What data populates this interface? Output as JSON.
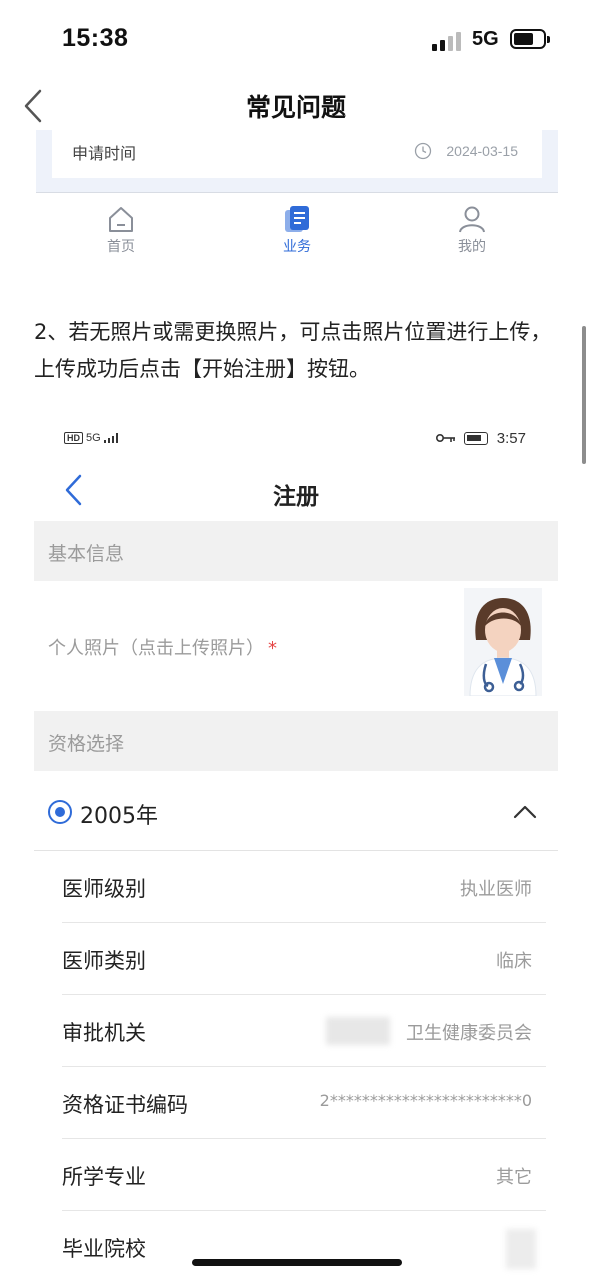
{
  "status_bar": {
    "time": "15:38",
    "network": "5G"
  },
  "header": {
    "title": "常见问题"
  },
  "fragment": {
    "label": "申请时间",
    "date": "2024-03-15",
    "tabs": [
      {
        "label": "首页",
        "icon": "home-icon"
      },
      {
        "label": "业务",
        "icon": "business-doc-icon",
        "active": true
      },
      {
        "label": "我的",
        "icon": "user-icon"
      }
    ]
  },
  "instruction": "2、若无照片或需更换照片，可点击照片位置进行上传，上传成功后点击【开始注册】按钮。",
  "screenshot": {
    "status_left": "5G",
    "status_time": "3:57",
    "title": "注册",
    "section_basic": "基本信息",
    "photo_label": "个人照片（点击上传照片）",
    "required_mark": "*",
    "section_qualification": "资格选择",
    "year": "2005年",
    "rows": [
      {
        "label": "医师级别",
        "value": "执业医师"
      },
      {
        "label": "医师类别",
        "value": "临床"
      },
      {
        "label": "审批机关",
        "value": "卫生健康委员会"
      },
      {
        "label": "资格证书编码",
        "value": "2************************0"
      },
      {
        "label": "所学专业",
        "value": "其它"
      },
      {
        "label": "毕业院校",
        "value": ""
      }
    ]
  },
  "colors": {
    "accent": "#2f6bd8",
    "required": "#e54545",
    "muted": "#9b9b9b"
  }
}
